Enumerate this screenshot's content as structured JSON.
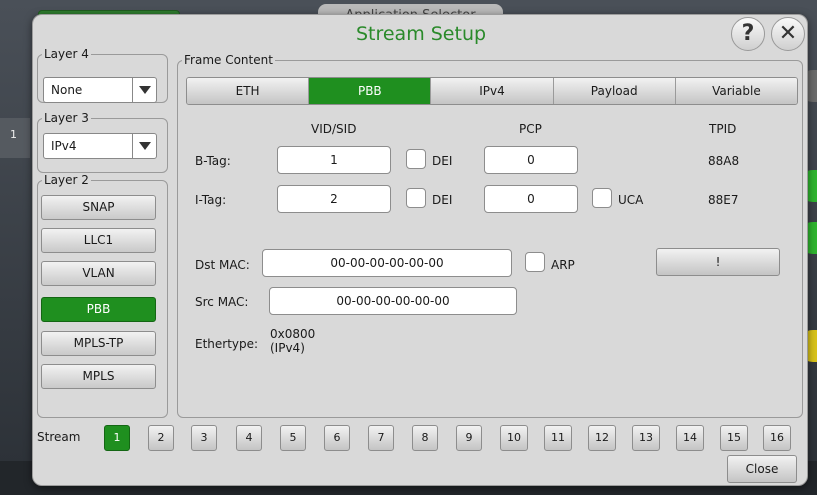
{
  "background": {
    "app_tab_label": "Application Selector",
    "left_marker": "1"
  },
  "dialog": {
    "title": "Stream Setup",
    "help_glyph": "?",
    "close_glyph": "✕"
  },
  "layer4": {
    "legend": "Layer 4",
    "selected": "None"
  },
  "layer3": {
    "legend": "Layer 3",
    "selected": "IPv4"
  },
  "layer2": {
    "legend": "Layer 2",
    "buttons": [
      "SNAP",
      "LLC1",
      "VLAN",
      "PBB",
      "MPLS-TP",
      "MPLS"
    ],
    "active": "PBB"
  },
  "frame": {
    "legend": "Frame Content",
    "tabs": [
      "ETH",
      "PBB",
      "IPv4",
      "Payload",
      "Variable"
    ],
    "active_tab": "PBB",
    "headers": {
      "vid": "VID/SID",
      "pcp": "PCP",
      "tpid": "TPID"
    },
    "btag": {
      "label": "B-Tag:",
      "vid": "1",
      "dei": "DEI",
      "pcp": "0",
      "tpid": "88A8"
    },
    "itag": {
      "label": "I-Tag:",
      "vid": "2",
      "dei": "DEI",
      "pcp": "0",
      "uca": "UCA",
      "tpid": "88E7"
    },
    "dst": {
      "label": "Dst MAC:",
      "value": "00-00-00-00-00-00",
      "arp": "ARP"
    },
    "src": {
      "label": "Src MAC:",
      "value": "00-00-00-00-00-00"
    },
    "ethertype": {
      "label": "Ethertype:",
      "value": "0x0800",
      "sub": "(IPv4)"
    },
    "bang_button": "!"
  },
  "stream": {
    "label": "Stream",
    "numbers": [
      "1",
      "2",
      "3",
      "4",
      "5",
      "6",
      "7",
      "8",
      "9",
      "10",
      "11",
      "12",
      "13",
      "14",
      "15",
      "16"
    ],
    "active": "1"
  },
  "close_button": "Close",
  "colors": {
    "accent": "#1f8f1f",
    "title": "#2a8a2a"
  }
}
